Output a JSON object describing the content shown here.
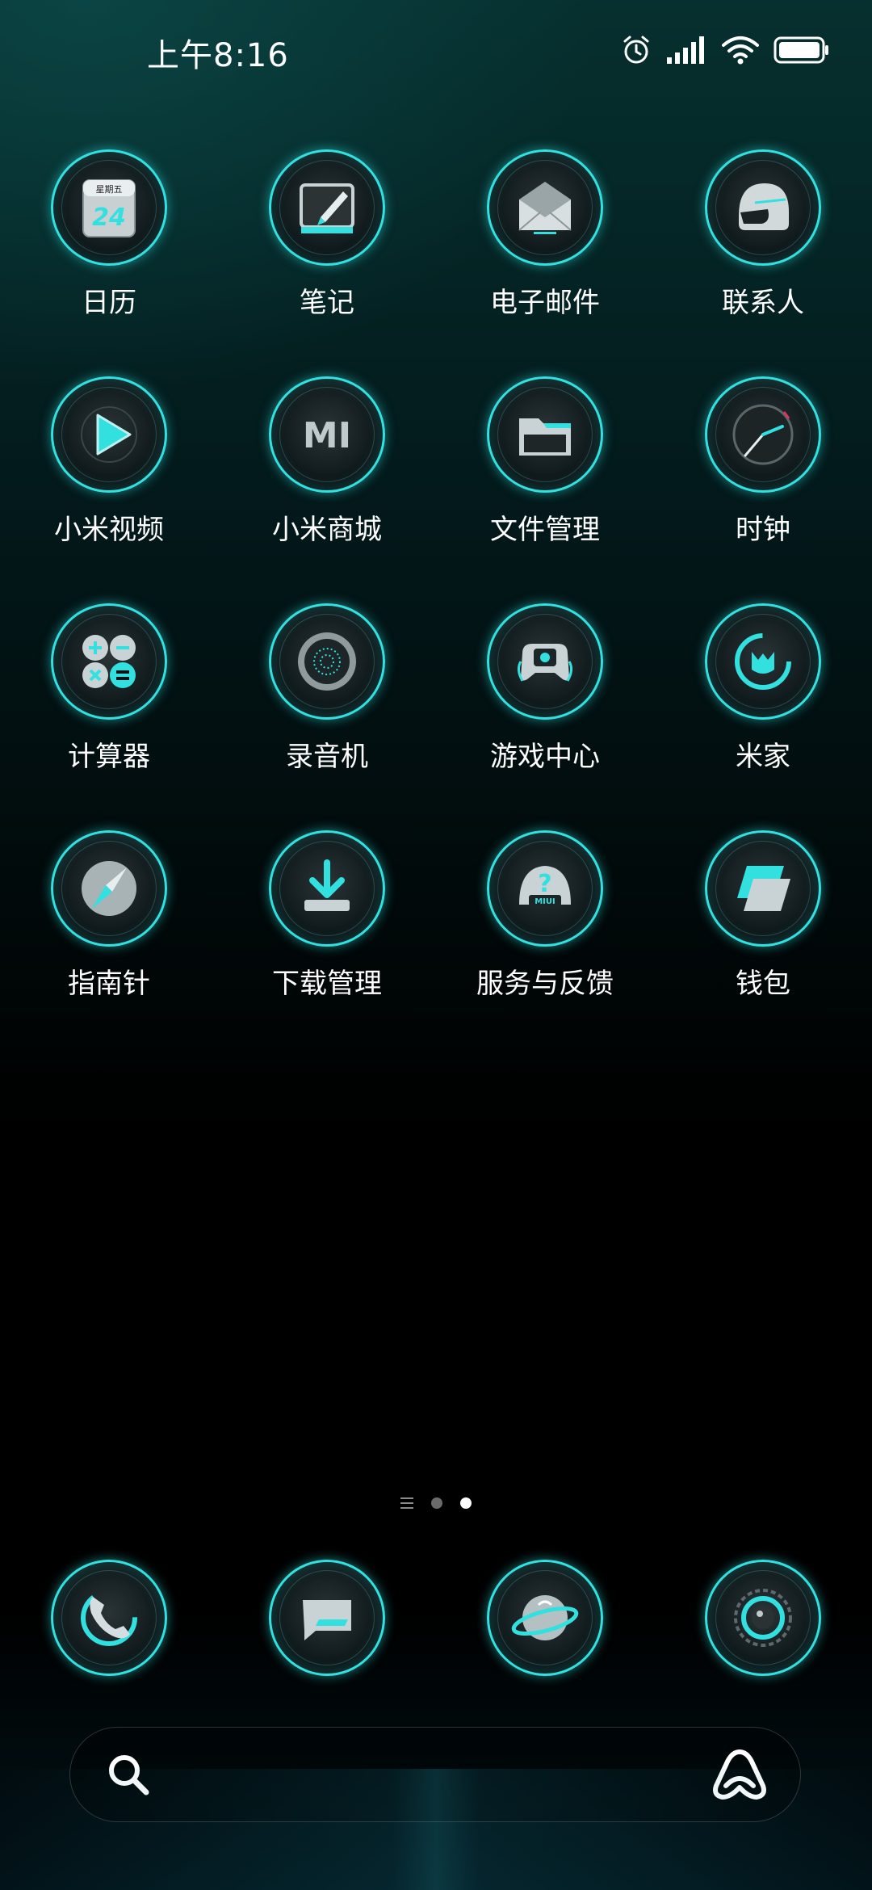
{
  "status_bar": {
    "time": "上午8:16",
    "icons": [
      "alarm-icon",
      "signal-icon",
      "wifi-icon",
      "battery-icon"
    ]
  },
  "apps": [
    {
      "label": "日历",
      "icon": "calendar-icon",
      "icon_text_top": "星期五",
      "icon_text_main": "24"
    },
    {
      "label": "笔记",
      "icon": "notes-icon"
    },
    {
      "label": "电子邮件",
      "icon": "email-icon"
    },
    {
      "label": "联系人",
      "icon": "contacts-icon"
    },
    {
      "label": "小米视频",
      "icon": "video-icon"
    },
    {
      "label": "小米商城",
      "icon": "mi-store-icon",
      "icon_text": "MI"
    },
    {
      "label": "文件管理",
      "icon": "file-manager-icon"
    },
    {
      "label": "时钟",
      "icon": "clock-icon"
    },
    {
      "label": "计算器",
      "icon": "calculator-icon"
    },
    {
      "label": "录音机",
      "icon": "recorder-icon"
    },
    {
      "label": "游戏中心",
      "icon": "game-center-icon"
    },
    {
      "label": "米家",
      "icon": "mijia-icon"
    },
    {
      "label": "指南针",
      "icon": "compass-icon"
    },
    {
      "label": "下载管理",
      "icon": "download-icon"
    },
    {
      "label": "服务与反馈",
      "icon": "feedback-icon",
      "icon_text": "MIUI"
    },
    {
      "label": "钱包",
      "icon": "wallet-icon"
    }
  ],
  "page_indicator": {
    "pages": 2,
    "active": 2
  },
  "dock": [
    {
      "icon": "phone-icon"
    },
    {
      "icon": "messages-icon"
    },
    {
      "icon": "browser-icon"
    },
    {
      "icon": "camera-icon"
    }
  ],
  "search_bar": {
    "placeholder": ""
  },
  "colors": {
    "accent": "#33e0e0",
    "background": "#000000"
  }
}
